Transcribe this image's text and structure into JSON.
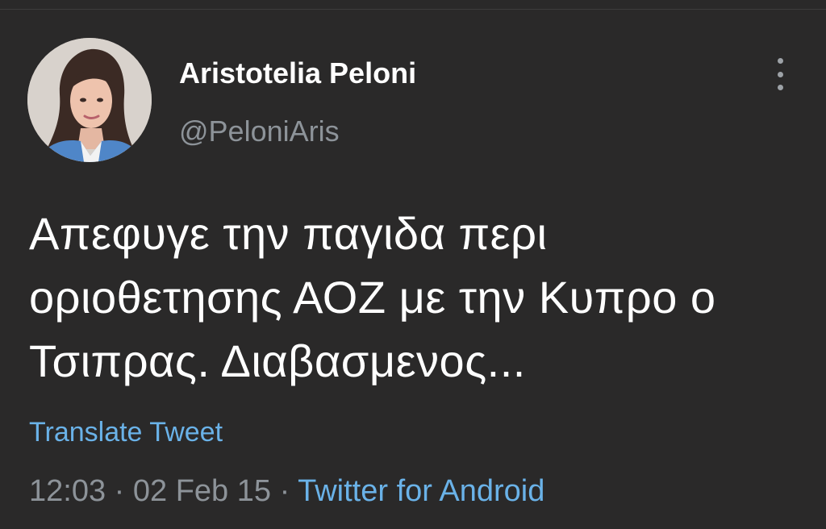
{
  "author": {
    "display_name": "Aristotelia Peloni",
    "handle": "@PeloniAris",
    "avatar_icon": "profile-photo"
  },
  "menu_icon": "more-vertical-icon",
  "tweet": {
    "lines": [
      "Απεφυγε την παγιδα περι",
      "οριοθετησης ΑΟΖ με την Κυπρο ο",
      "Τσιπρας. Διαβασμενος..."
    ]
  },
  "translate_label": "Translate Tweet",
  "meta": {
    "time": "12:03",
    "separator": " · ",
    "date": "02 Feb 15",
    "source": "Twitter for Android"
  },
  "colors": {
    "background": "#2a2929",
    "text": "#ffffff",
    "secondary_text": "#8d9399",
    "link": "#6ab2e8"
  }
}
